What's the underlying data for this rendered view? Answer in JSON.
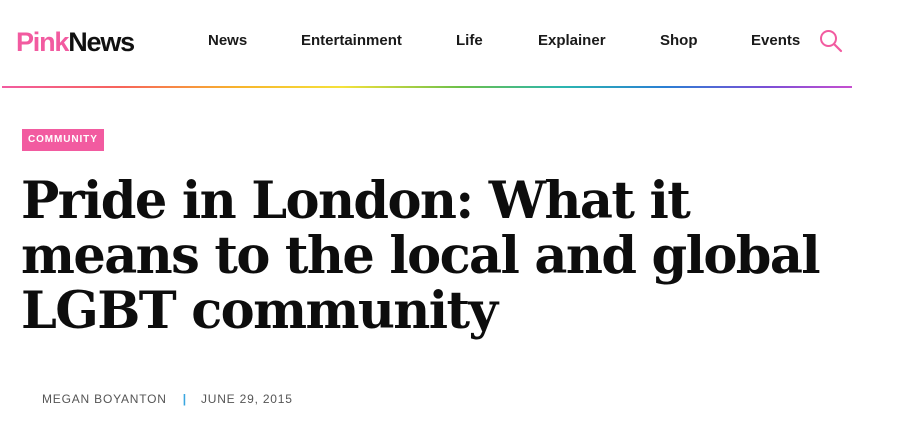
{
  "site": {
    "logo_part1": "Pink",
    "logo_part2": "News",
    "brand_color": "#f25ba0"
  },
  "nav": {
    "items": [
      "News",
      "Entertainment",
      "Life",
      "Explainer",
      "Shop",
      "Events"
    ],
    "search_icon": "search-icon"
  },
  "article": {
    "category": "COMMUNITY",
    "headline": "Pride in London: What it means to the local and global LGBT community",
    "author": "MEGAN BOYANTON",
    "separator": "|",
    "date": "JUNE 29, 2015",
    "separator_color": "#3aa6e0"
  }
}
